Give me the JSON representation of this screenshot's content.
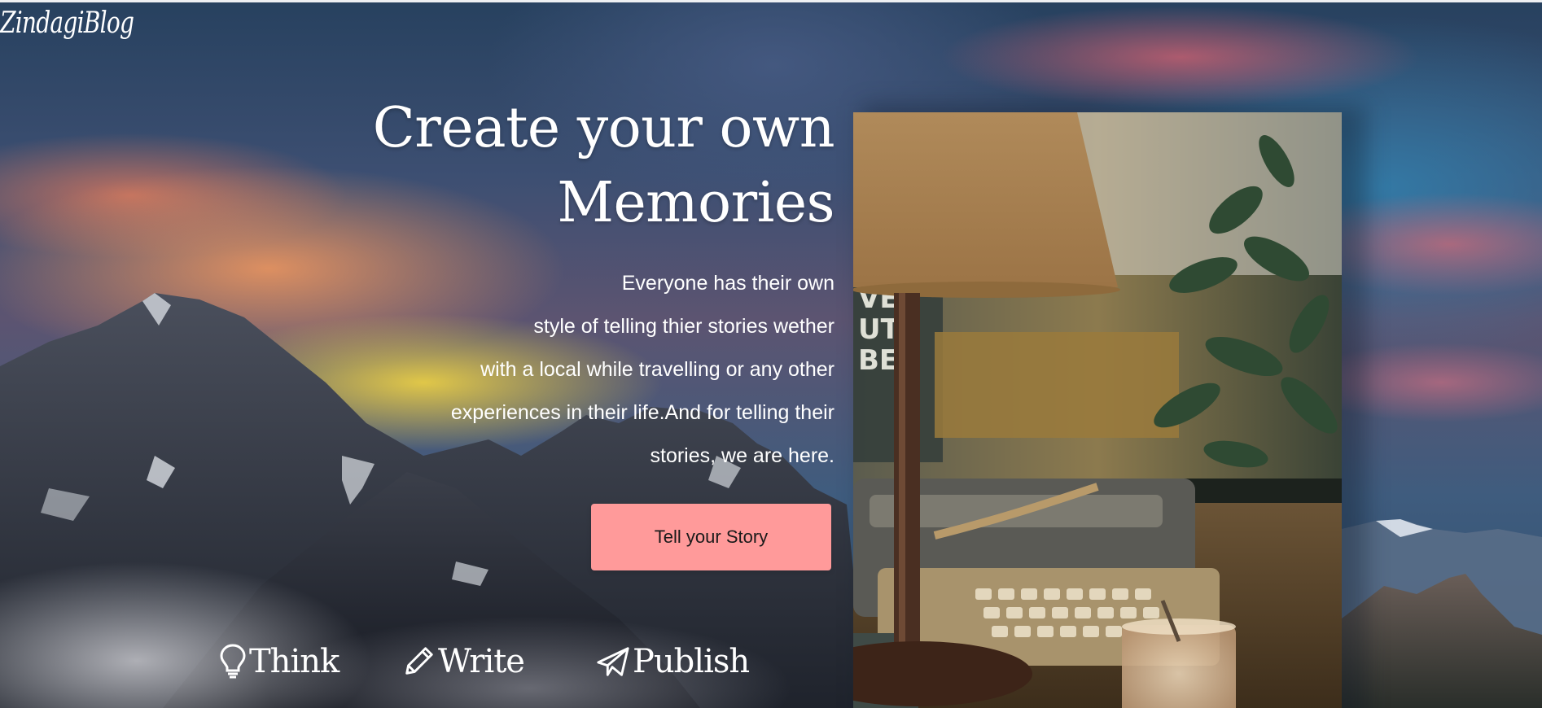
{
  "brand": {
    "logo": "ZindagiBlog"
  },
  "hero": {
    "title_lines": [
      "Create your own",
      "Memories"
    ],
    "description_lines": [
      "Everyone has their own",
      "style of telling thier stories wether",
      "with a local while travelling or any other",
      "experiences in their life.And for telling their",
      "stories, we are here."
    ],
    "cta_label": "Tell your Story"
  },
  "steps": [
    {
      "icon": "lightbulb-icon",
      "label": "Think"
    },
    {
      "icon": "pencil-icon",
      "label": "Write"
    },
    {
      "icon": "paper-plane-icon",
      "label": "Publish"
    }
  ],
  "colors": {
    "cta": "#ff9a9a",
    "text": "#ffffff"
  }
}
